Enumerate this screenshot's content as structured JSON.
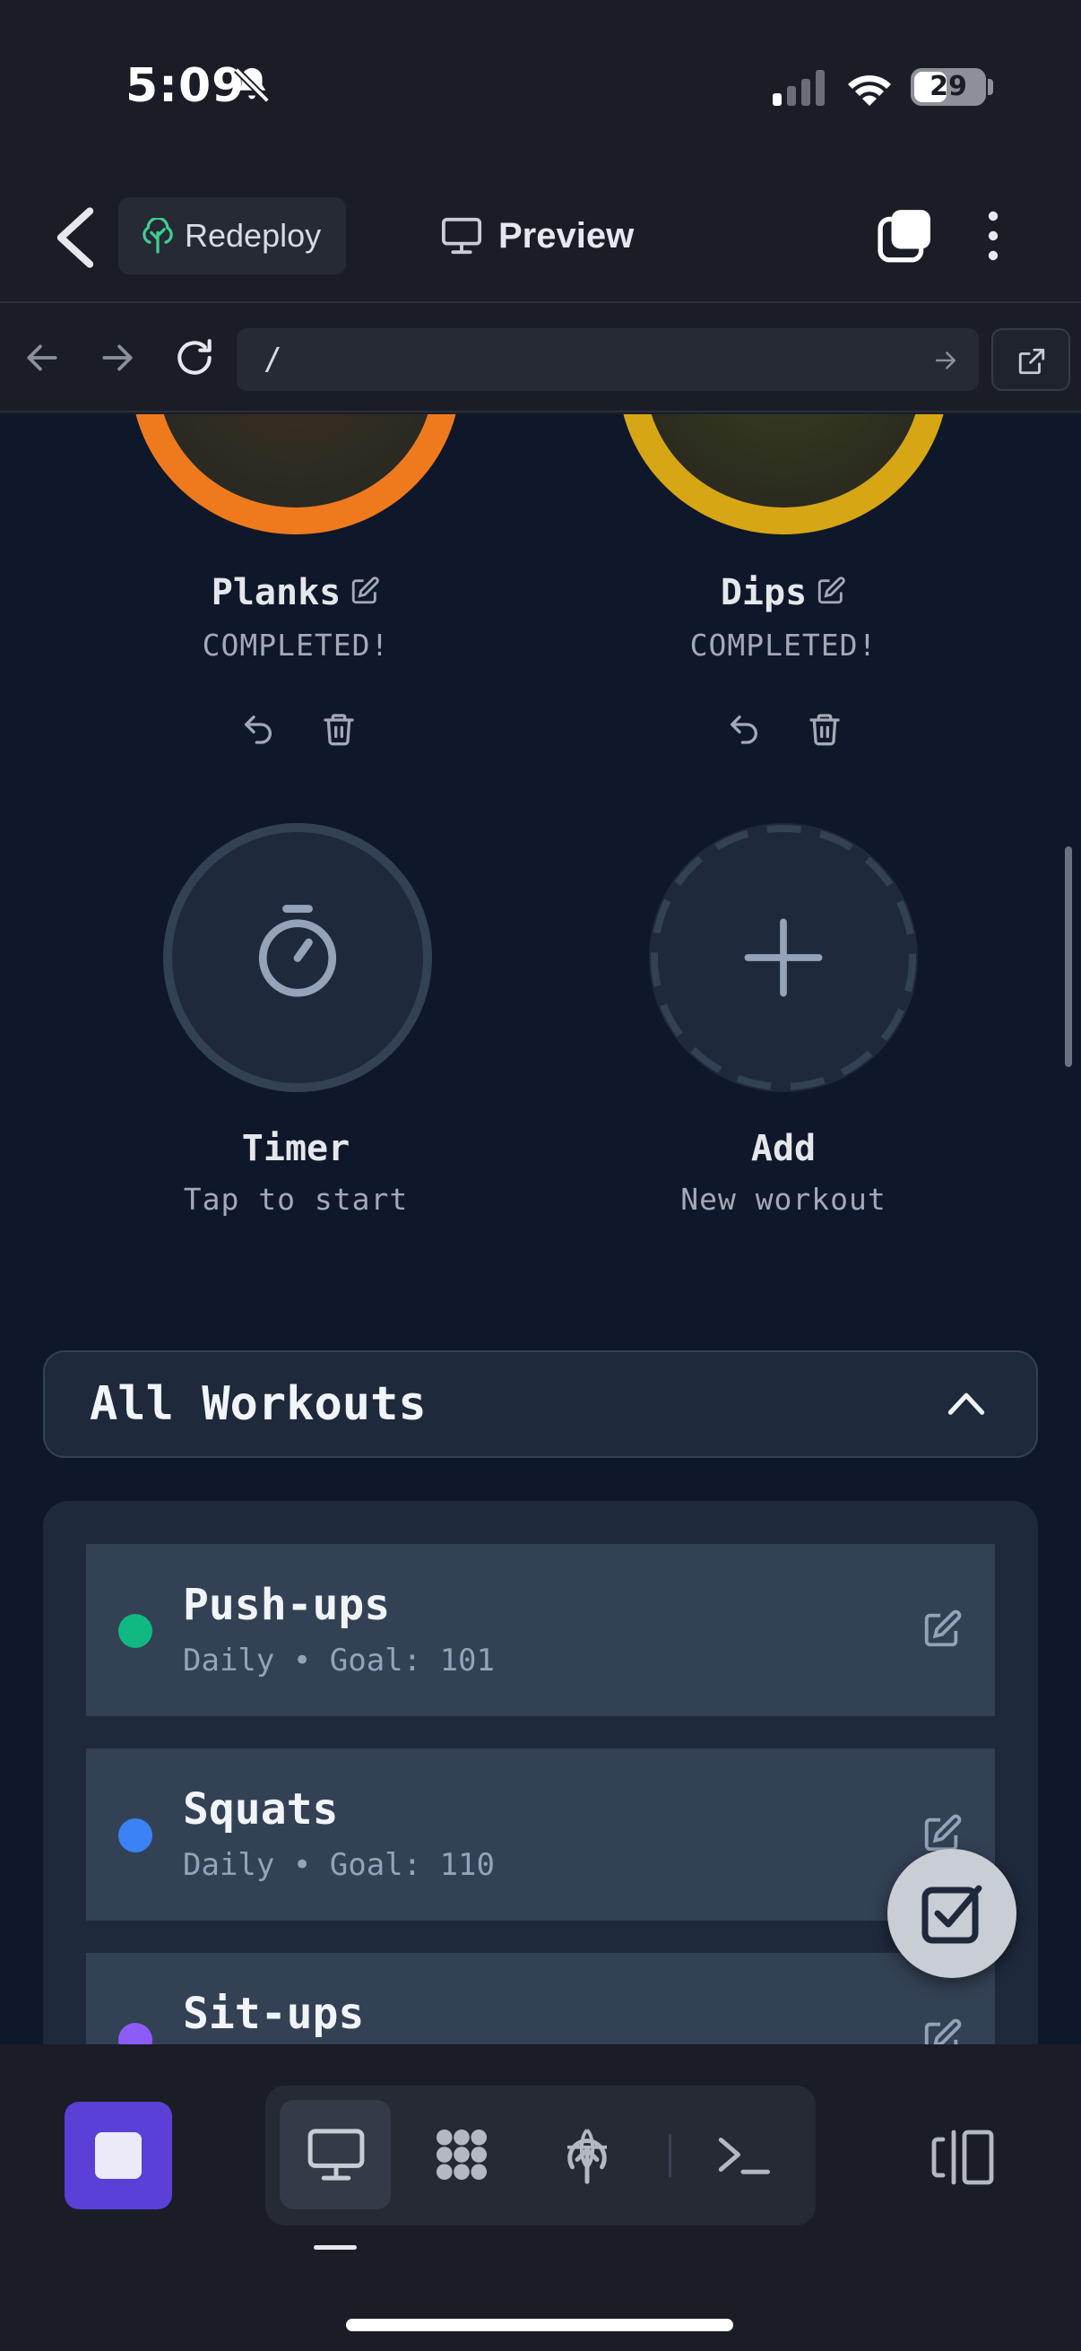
{
  "status_bar": {
    "time": "5:09",
    "battery": "29"
  },
  "header": {
    "redeploy_label": "Redeploy",
    "preview_label": "Preview"
  },
  "browser": {
    "url": "/"
  },
  "cards": [
    {
      "title": "Planks",
      "status": "COMPLETED!",
      "ring_color": "#ef7a1e"
    },
    {
      "title": "Dips",
      "status": "COMPLETED!",
      "ring_color": "#d6a615"
    }
  ],
  "timer": {
    "title": "Timer",
    "subtitle": "Tap to start"
  },
  "add": {
    "title": "Add",
    "subtitle": "New workout"
  },
  "section": {
    "title": "All Workouts"
  },
  "workouts": [
    {
      "name": "Push-ups",
      "meta": "Daily • Goal: 101",
      "color": "#10b981"
    },
    {
      "name": "Squats",
      "meta": "Daily • Goal: 110",
      "color": "#3b82f6"
    },
    {
      "name": "Sit-ups",
      "meta": "",
      "color": "#8b5cf6"
    }
  ],
  "icons": [
    "bell-slash-icon",
    "signal-icon",
    "wifi-icon",
    "back-icon",
    "tree-icon",
    "monitor-icon",
    "tabs-icon",
    "kebab-icon",
    "arrow-left-icon",
    "arrow-right-icon",
    "reload-icon",
    "external-link-icon",
    "edit-icon",
    "undo-icon",
    "trash-icon",
    "stopwatch-icon",
    "plus-icon",
    "chevron-up-icon",
    "checkbox-icon",
    "stop-icon",
    "grid-icon",
    "deploy-icon",
    "terminal-icon",
    "split-view-icon"
  ]
}
